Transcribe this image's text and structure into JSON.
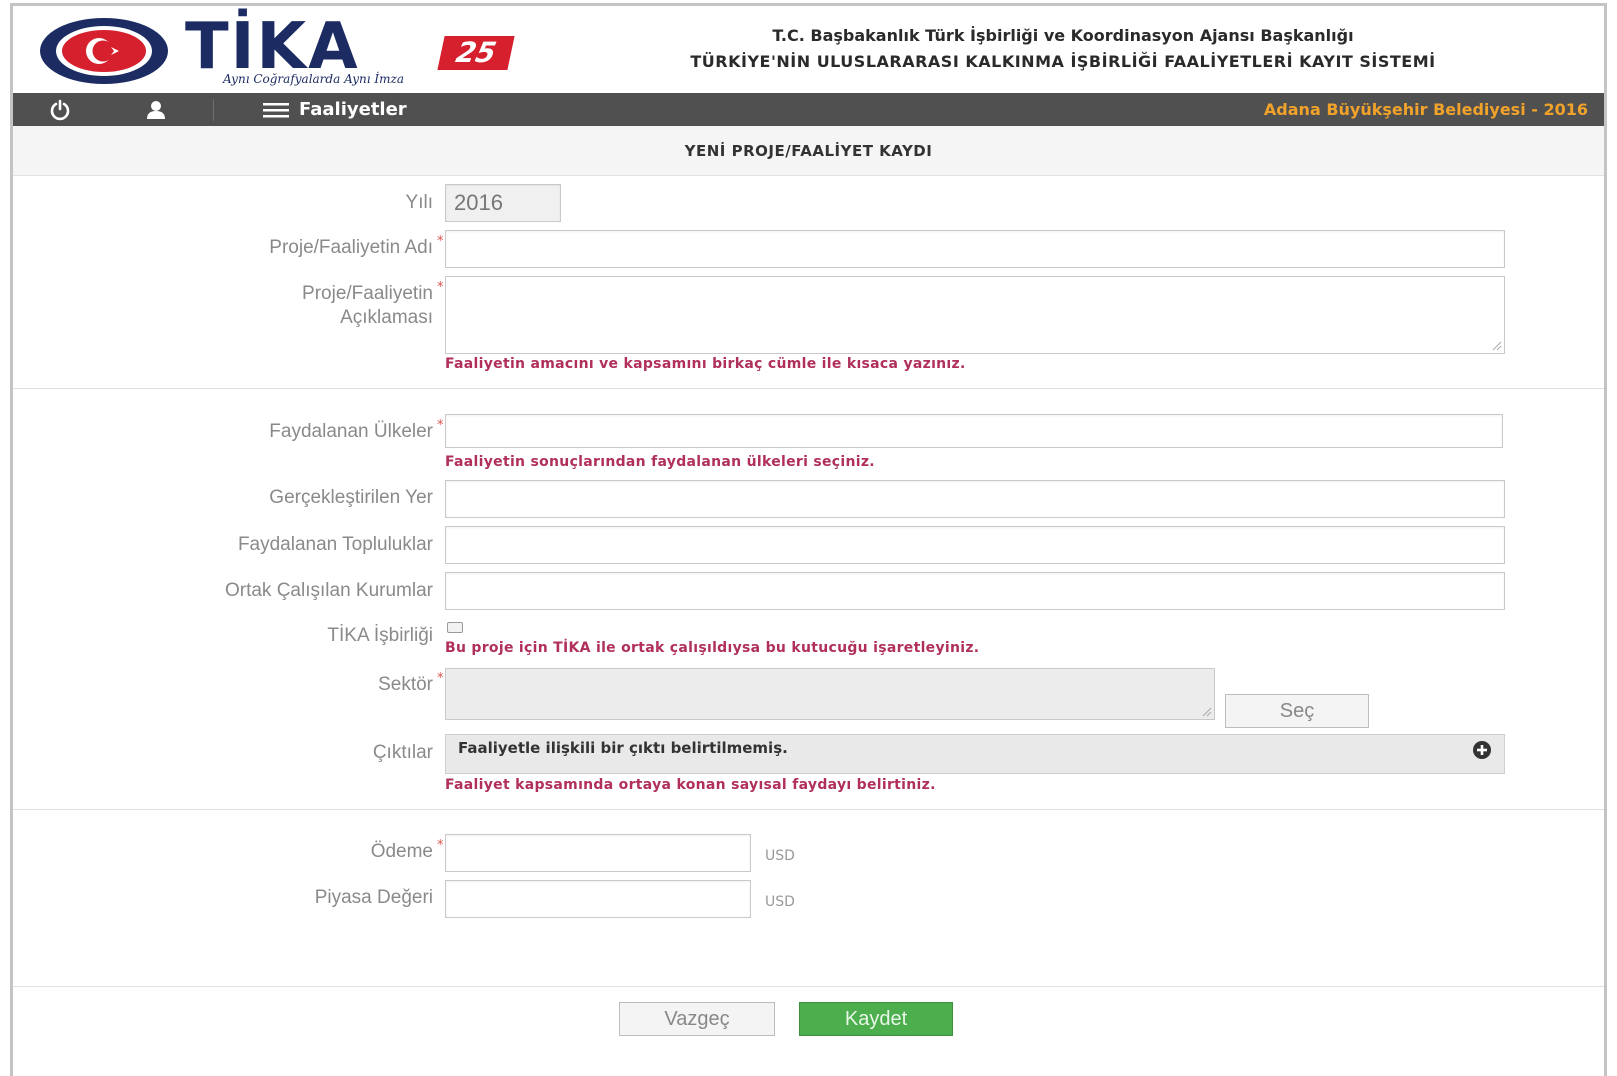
{
  "header": {
    "logo_text": "TİKA",
    "logo_badge": "25",
    "logo_slogan": "Aynı Coğrafyalarda Aynı İmza",
    "title_line1": "T.C. Başbakanlık Türk İşbirliği ve Koordinasyon Ajansı Başkanlığı",
    "title_line2": "TÜRKİYE'NİN ULUSLARARASI KALKINMA İŞBİRLİĞİ FAALİYETLERİ KAYIT SİSTEMİ"
  },
  "navbar": {
    "menu_label": "Faaliyetler",
    "organization": "Adana Büyükşehir Belediyesi - 2016",
    "icons": [
      "power-icon",
      "user-icon",
      "hamburger-icon"
    ]
  },
  "form": {
    "title": "YENİ PROJE/FAALİYET KAYDI",
    "year": {
      "label": "Yılı",
      "value": "2016"
    },
    "name": {
      "label": "Proje/Faaliyetin Adı",
      "value": ""
    },
    "description": {
      "label_line1": "Proje/Faaliyetin",
      "label_line2": "Açıklaması",
      "help": "Faaliyetin amacını ve kapsamını birkaç cümle ile kısaca yazınız."
    },
    "countries": {
      "label": "Faydalanan Ülkeler",
      "help": "Faaliyetin sonuçlarından faydalanan ülkeleri seçiniz."
    },
    "location": {
      "label": "Gerçekleştirilen Yer"
    },
    "communities": {
      "label": "Faydalanan Topluluklar"
    },
    "partners": {
      "label": "Ortak Çalışılan Kurumlar"
    },
    "tika_cooperation": {
      "label": "TİKA İşbirliği",
      "help": "Bu proje için TİKA ile ortak çalışıldıysa bu kutucuğu işaretleyiniz."
    },
    "sector": {
      "label": "Sektör",
      "select_button": "Seç"
    },
    "outputs": {
      "label": "Çıktılar",
      "empty_text": "Faaliyetle ilişkili bir çıktı belirtilmemiş.",
      "help": "Faaliyet kapsamında ortaya konan sayısal faydayı belirtiniz."
    },
    "payment": {
      "label": "Ödeme",
      "unit": "USD"
    },
    "market_value": {
      "label": "Piyasa Değeri",
      "unit": "USD"
    },
    "required_mark": "*"
  },
  "actions": {
    "cancel": "Vazgeç",
    "save": "Kaydet"
  }
}
